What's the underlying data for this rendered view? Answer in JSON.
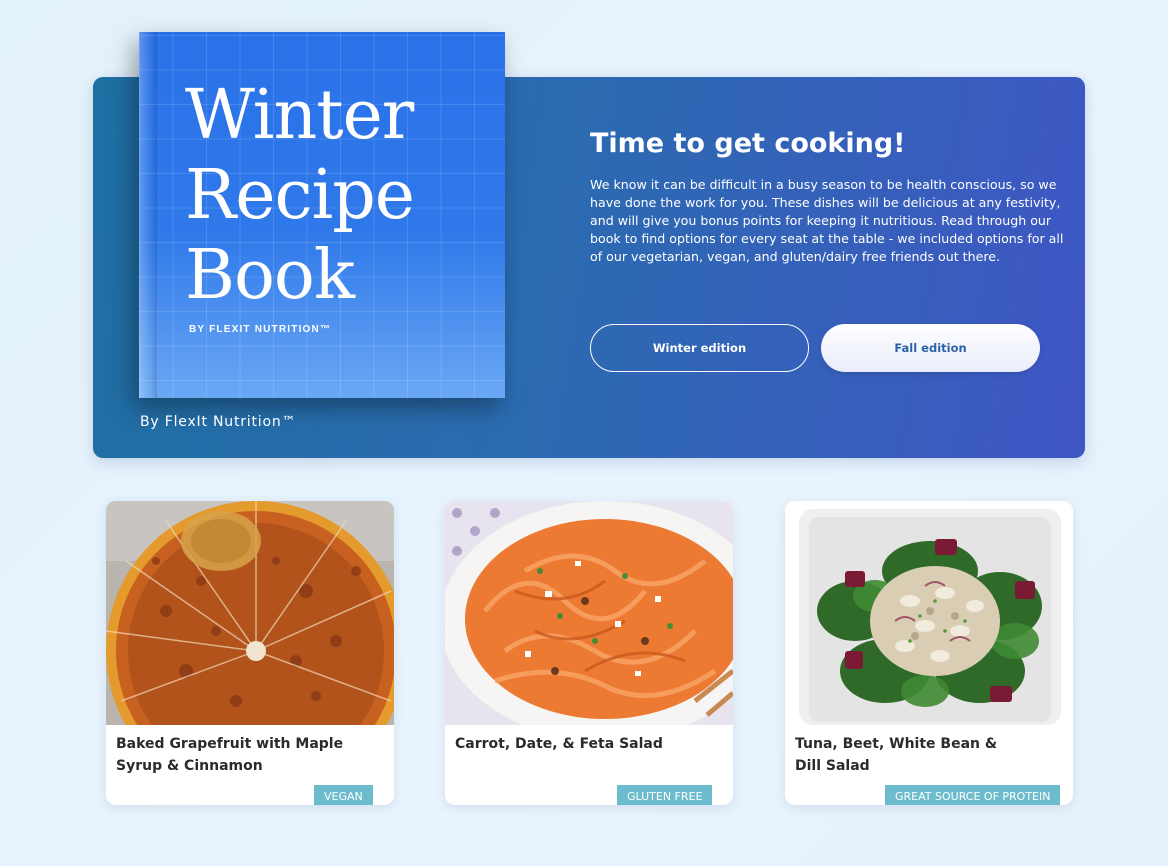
{
  "hero": {
    "book_title": "Winter\nRecipe\nBook",
    "book_subtitle": "BY FLEXIT NUTRITION™",
    "byline": "By FlexIt Nutrition™",
    "heading": "Time to get cooking!",
    "description": "We know it can be difficult in a busy season to be health conscious, so we have done the work for you. These dishes will be delicious at any festivity, and will give you bonus points for keeping it nutritious. Read through our book to find options for every seat at the table - we included options for all of our vegetarian, vegan, and gluten/dairy free friends out there.",
    "buttons": [
      {
        "label": "Winter edition"
      },
      {
        "label": "Fall edition"
      }
    ]
  },
  "recipes": [
    {
      "title": "Baked Grapefruit with Maple Syrup & Cinnamon",
      "tag": "VEGAN",
      "image": "baked-grapefruit-photo"
    },
    {
      "title": "Carrot, Date, & Feta Salad",
      "tag": "GLUTEN FREE",
      "image": "carrot-salad-photo"
    },
    {
      "title": "Tuna, Beet, White Bean & Dill Salad",
      "tag": "GREAT SOURCE OF PROTEIN",
      "image": "tuna-salad-photo"
    }
  ],
  "colors": {
    "hero_start": "#1f6fa3",
    "hero_end": "#3f56c4",
    "book_blue": "#2f79ea",
    "tag_teal": "#6dbccd",
    "fall_button_text": "#2d62a8"
  }
}
